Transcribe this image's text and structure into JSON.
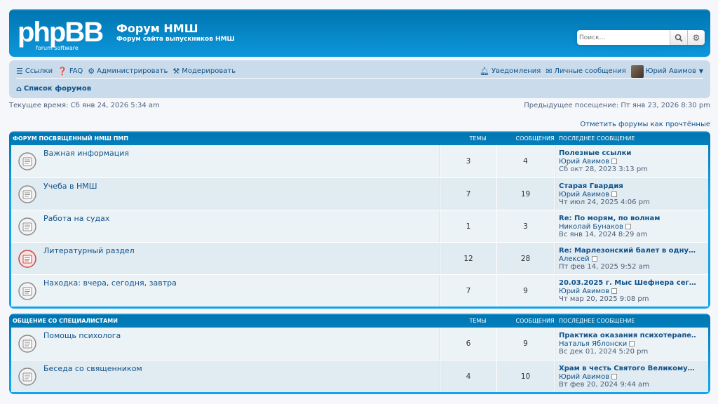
{
  "header": {
    "logo_main": "phpBB",
    "logo_sub": "forum  software",
    "title": "Форум НМШ",
    "description": "Форум сайта выпускников НМШ",
    "search_placeholder": "Поиск…"
  },
  "nav": {
    "links": "Ссылки",
    "faq": "FAQ",
    "admin": "Администрировать",
    "moderate": "Модерировать",
    "notifications": "Уведомления",
    "messages": "Личные сообщения",
    "user": "Юрий Авимов",
    "breadcrumb": "Список форумов"
  },
  "times": {
    "current": "Текущее время: Сб янв 24, 2026 5:34 am",
    "last_visit": "Предыдущее посещение: Пт янв 23, 2026 8:30 pm",
    "mark_read": "Отметить форумы как прочтённые"
  },
  "categories": [
    {
      "name": "Форум посвященный НМШ ПМП",
      "col_topics": "Темы",
      "col_posts": "Сообщения",
      "col_last": "Последнее сообщение",
      "forums": [
        {
          "title": "Важная информация",
          "topics": "3",
          "posts": "4",
          "last_title": "Полезные ссылки",
          "last_author": "Юрий Авимов",
          "last_date": "Сб окт 28, 2023 3:13 pm",
          "unread": false
        },
        {
          "title": "Учеба в НМШ",
          "topics": "7",
          "posts": "19",
          "last_title": "Старая Гвардия",
          "last_author": "Юрий Авимов",
          "last_date": "Чт июл 24, 2025 4:06 pm",
          "unread": false
        },
        {
          "title": "Работа на судах",
          "topics": "1",
          "posts": "3",
          "last_title": "Re: По морям, по волнам",
          "last_author": "Николай Бунаков",
          "last_date": "Вс янв 14, 2024 8:29 am",
          "unread": false
        },
        {
          "title": "Литературный раздел",
          "topics": "12",
          "posts": "28",
          "last_title": "Re: Марлезонский балет в одну…",
          "last_author": "Алексей",
          "last_date": "Пт фев 14, 2025 9:52 am",
          "unread": true
        },
        {
          "title": "Находка: вчера, сегодня, завтра",
          "topics": "7",
          "posts": "9",
          "last_title": "20.03.2025 г. Мыс Шефнера сег…",
          "last_author": "Юрий Авимов",
          "last_date": "Чт мар 20, 2025 9:08 pm",
          "unread": false
        }
      ]
    },
    {
      "name": "Общение со специалистами",
      "col_topics": "Темы",
      "col_posts": "Сообщения",
      "col_last": "Последнее сообщение",
      "forums": [
        {
          "title": "Помощь психолога",
          "topics": "6",
          "posts": "9",
          "last_title": "Практика оказания психотерапе…",
          "last_author": "Наталья Яблонски",
          "last_date": "Вс дек 01, 2024 5:20 pm",
          "unread": false
        },
        {
          "title": "Беседа со священником",
          "topics": "4",
          "posts": "10",
          "last_title": "Храм в честь Святого Великому…",
          "last_author": "Юрий Авимов",
          "last_date": "Вт фев 20, 2024 9:44 am",
          "unread": false
        }
      ]
    }
  ],
  "colors": {
    "accent": "#105289",
    "header_blue": "#12a3eb",
    "nav_bg": "#cadceb",
    "unread_icon": "#c64a4a"
  }
}
